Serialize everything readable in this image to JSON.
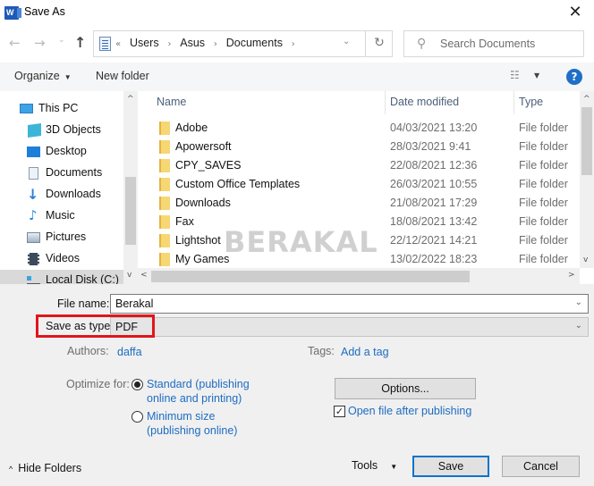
{
  "window": {
    "title": "Save As",
    "app_icon": "word-icon",
    "close_glyph": "✕"
  },
  "nav": {
    "back_glyph": "←",
    "forward_glyph": "→",
    "recent_glyph": "⌄",
    "up_glyph": "↑",
    "breadcrumb": {
      "overflow": "«",
      "items": [
        "Users",
        "Asus",
        "Documents"
      ],
      "separator": "›"
    },
    "dropdown_glyph": "⌄",
    "refresh_glyph": "↻",
    "search": {
      "placeholder": "Search Documents",
      "icon_glyph": "⚲"
    }
  },
  "toolbar": {
    "organize_label": "Organize",
    "dropdown_glyph": "▼",
    "new_folder_label": "New folder",
    "view_glyph": "☷",
    "help_glyph": "?"
  },
  "sidebar": {
    "items": [
      {
        "label": "This PC",
        "icon": "computer-icon"
      },
      {
        "label": "3D Objects",
        "icon": "3d-objects-icon"
      },
      {
        "label": "Desktop",
        "icon": "desktop-icon"
      },
      {
        "label": "Documents",
        "icon": "documents-icon"
      },
      {
        "label": "Downloads",
        "icon": "downloads-icon"
      },
      {
        "label": "Music",
        "icon": "music-icon"
      },
      {
        "label": "Pictures",
        "icon": "pictures-icon"
      },
      {
        "label": "Videos",
        "icon": "videos-icon"
      },
      {
        "label": "Local Disk (C:)",
        "icon": "drive-icon",
        "selected": true
      }
    ]
  },
  "filelist": {
    "columns": {
      "name": "Name",
      "date": "Date modified",
      "type": "Type"
    },
    "sort_glyph": "^",
    "rows": [
      {
        "name": "Adobe",
        "date": "04/03/2021 13:20",
        "type": "File folder"
      },
      {
        "name": "Apowersoft",
        "date": "28/03/2021 9:41",
        "type": "File folder"
      },
      {
        "name": "CPY_SAVES",
        "date": "22/08/2021 12:36",
        "type": "File folder"
      },
      {
        "name": "Custom Office Templates",
        "date": "26/03/2021 10:55",
        "type": "File folder"
      },
      {
        "name": "Downloads",
        "date": "21/08/2021 17:29",
        "type": "File folder"
      },
      {
        "name": "Fax",
        "date": "18/08/2021 13:42",
        "type": "File folder"
      },
      {
        "name": "Lightshot",
        "date": "22/12/2021 14:21",
        "type": "File folder"
      },
      {
        "name": "My Games",
        "date": "13/02/2022 18:23",
        "type": "File folder"
      }
    ]
  },
  "scroll_glyphs": {
    "up": "^",
    "down": "v",
    "left": "<",
    "right": ">"
  },
  "watermark": "BERAKAL",
  "form": {
    "file_name_label": "File name:",
    "file_name_value": "Berakal",
    "save_type_label": "Save as type:",
    "save_type_value": "PDF",
    "authors_label": "Authors:",
    "authors_value": "daffa",
    "tags_label": "Tags:",
    "tags_value": "Add a tag",
    "optimize_label": "Optimize for:",
    "optimize_options": [
      {
        "line1": "Standard (publishing",
        "line2": "online and printing)",
        "checked": true
      },
      {
        "line1": "Minimum size",
        "line2": "(publishing online)",
        "checked": false
      }
    ],
    "options_button": "Options...",
    "open_after_label": "Open file after publishing",
    "open_after_checked": true,
    "check_glyph": "✓",
    "dropdown_glyph": "⌄"
  },
  "footer": {
    "hide_folders_label": "Hide Folders",
    "hide_caret": "^",
    "tools_label": "Tools",
    "tools_caret": "▼",
    "save_label": "Save",
    "cancel_label": "Cancel"
  },
  "colors": {
    "accent": "#0f73c9",
    "link": "#1e6cc1",
    "highlight": "#e0161b"
  }
}
